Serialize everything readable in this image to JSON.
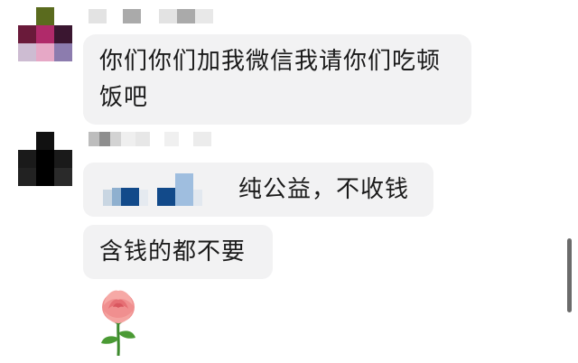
{
  "messages": [
    {
      "text": "你们你们加我微信我请你们吃顿饭吧"
    },
    {
      "text": "纯公益，不收钱"
    },
    {
      "text": "含钱的都不要"
    }
  ],
  "emoji": {
    "name": "rose"
  },
  "colors": {
    "bubble": "#f2f2f3",
    "text": "#1a1a1a",
    "background": "#ffffff",
    "scrollbar": "#6b6b6b"
  }
}
